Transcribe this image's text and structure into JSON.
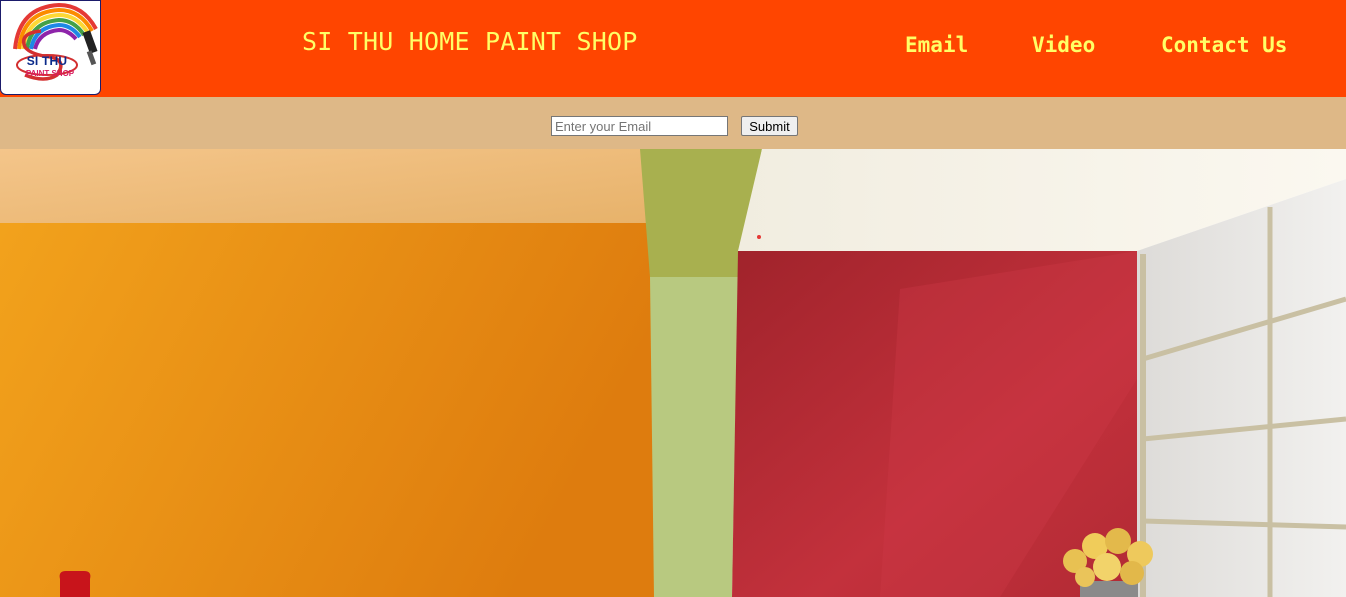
{
  "logo": {
    "line1": "SI THU",
    "line2": "PAINT SHOP"
  },
  "header": {
    "title": "SI THU HOME PAINT SHOP",
    "nav": {
      "email": "Email",
      "video": "Video",
      "contact": "Contact Us"
    }
  },
  "subscribe": {
    "placeholder": "Enter your Email",
    "submit_label": "Submit"
  },
  "colors": {
    "header_bg": "#ff4500",
    "header_text": "#ffff66",
    "subscribe_bg": "#deb887"
  }
}
